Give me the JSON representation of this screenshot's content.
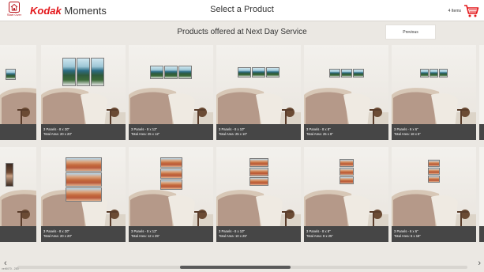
{
  "header": {
    "start_over_label": "Start Over",
    "brand_primary": "Kodak",
    "brand_secondary": "Moments",
    "title": "Select a Product",
    "cart_count": "4 Items",
    "cart_icon": "cart-icon",
    "home_icon": "home-icon"
  },
  "subbar": {
    "title": "Products offered at Next Day Service",
    "previous_label": "Previous"
  },
  "rows": [
    {
      "artwork": "sea",
      "tiles": [
        {
          "line1": "3 Panels - 8 x 20\"",
          "line2": "Total Area: 20 x 20\""
        },
        {
          "line1": "3 Panels - 8 x 12\"",
          "line2": "Total Area: 25 x 12\""
        },
        {
          "line1": "3 Panels - 8 x 10\"",
          "line2": "Total Area: 25 x 10\""
        },
        {
          "line1": "3 Panels - 8 x 8\"",
          "line2": "Total Area: 25 x 8\""
        },
        {
          "line1": "3 Panels - 6 x 6\"",
          "line2": "Total Area: 18 x 6\""
        }
      ]
    },
    {
      "artwork": "canyon",
      "tiles": [
        {
          "line1": "3 Panels - 8 x 20\"",
          "line2": "Total Area: 20 x 20\""
        },
        {
          "line1": "3 Panels - 8 x 12\"",
          "line2": "Total Area: 12 x 25\""
        },
        {
          "line1": "3 Panels - 8 x 10\"",
          "line2": "Total Area: 10 x 25\""
        },
        {
          "line1": "3 Panels - 8 x 8\"",
          "line2": "Total Area: 8 x 25\""
        },
        {
          "line1": "3 Panels - 6 x 6\"",
          "line2": "Total Area: 6 x 18\""
        }
      ]
    }
  ],
  "version": "ver8470 - 283",
  "colors": {
    "brand_red": "#e3161a",
    "caption_bg": "#464646",
    "page_bg": "#ebe8e3"
  }
}
